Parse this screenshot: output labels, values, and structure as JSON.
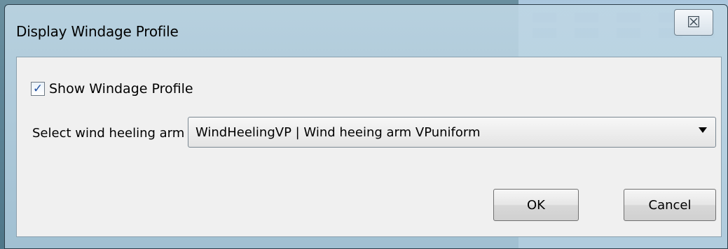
{
  "window": {
    "title": "Display Windage Profile",
    "close_icon": "close-icon",
    "close_glyph": "☒"
  },
  "form": {
    "show_profile_label": "Show Windage Profile",
    "show_profile_checked": true,
    "check_glyph": "✓",
    "select_label": "Select wind heeling arm",
    "select_value": "WindHeelingVP | Wind heeing arm VPuniform"
  },
  "buttons": {
    "ok": "OK",
    "cancel": "Cancel"
  }
}
